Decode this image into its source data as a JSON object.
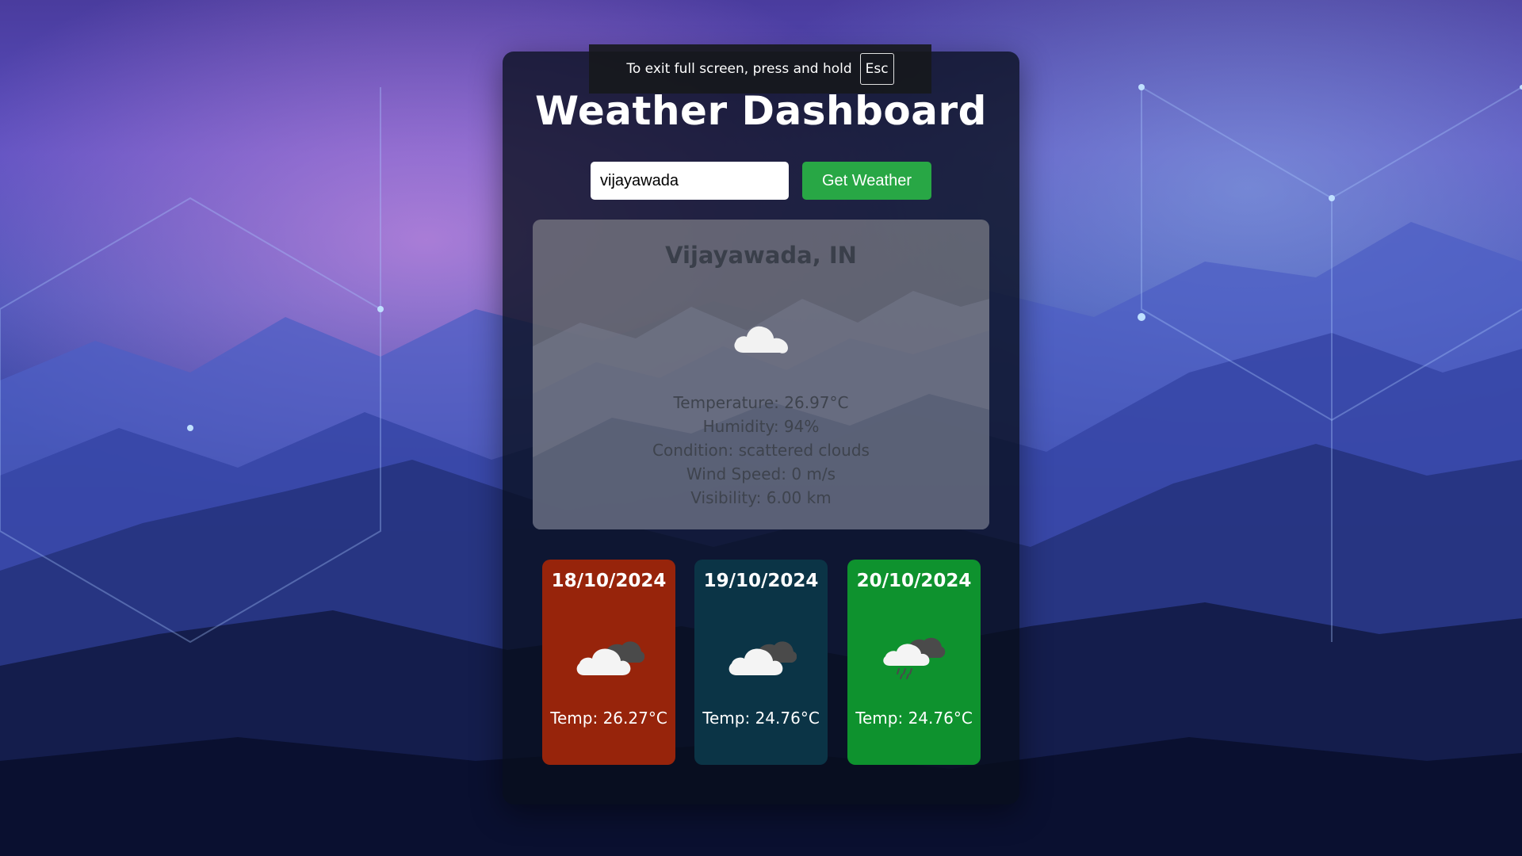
{
  "fullscreen_notice": {
    "text": "To exit full screen, press and hold",
    "key": "Esc"
  },
  "app": {
    "title": "Weather Dashboard"
  },
  "search": {
    "value": "vijayawada",
    "button_label": "Get Weather"
  },
  "current": {
    "city": "Vijayawada, IN",
    "icon": "cloud-icon",
    "temperature": "Temperature: 26.97°C",
    "humidity": "Humidity: 94%",
    "condition": "Condition: scattered clouds",
    "wind": "Wind Speed: 0 m/s",
    "visibility": "Visibility: 6.00 km"
  },
  "forecast": [
    {
      "date": "18/10/2024",
      "temp": "Temp: 26.27°C",
      "icon": "broken-clouds-icon",
      "color": "#97240b"
    },
    {
      "date": "19/10/2024",
      "temp": "Temp: 24.76°C",
      "icon": "broken-clouds-icon",
      "color": "#0b3446"
    },
    {
      "date": "20/10/2024",
      "temp": "Temp: 24.76°C",
      "icon": "rain-cloud-icon",
      "color": "#0e922e"
    }
  ],
  "colors": {
    "button": "#28a745",
    "card": "#080e1c"
  }
}
